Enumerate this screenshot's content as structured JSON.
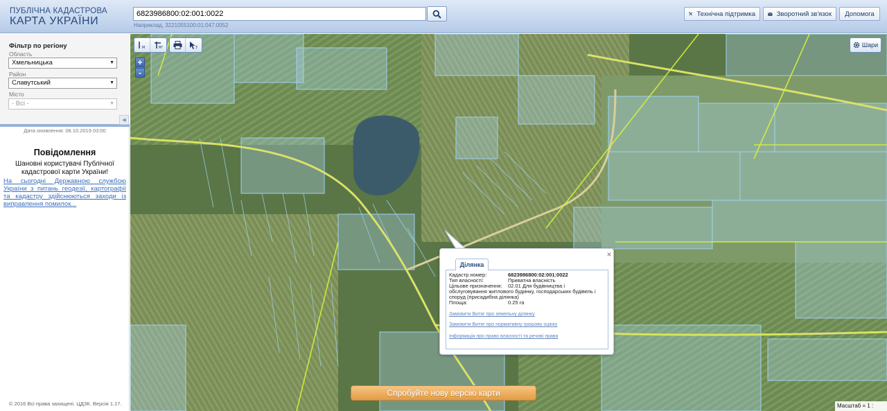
{
  "header": {
    "logo_line1": "ПУБЛІЧНА КАДАСТРОВА",
    "logo_line2": "КАРТА УКРАЇНИ",
    "search": {
      "value": "6823986800:02:001:0022",
      "hint": "Наприклад, 3221055100:01:047:0052"
    },
    "buttons": [
      {
        "label": "Технічна підтримка",
        "icon": "tools-icon"
      },
      {
        "label": "Зворотний зв'язок",
        "icon": "envelope-icon"
      },
      {
        "label": "Допомога"
      }
    ]
  },
  "sidebar": {
    "filter_title": "Фільтр по регіону",
    "region": {
      "label": "Область",
      "value": "Хмельницька"
    },
    "district": {
      "label": "Район",
      "value": "Славутський"
    },
    "city": {
      "label": "Місто",
      "value": "- Всі -"
    },
    "update_date": "Дата оновлення: 08.10.2019 03:00",
    "news": {
      "title": "Повідомлення",
      "body": "Шановні користувачі Публічної кадастрової карти України!",
      "link": "На сьогодні Державною службою України з питань геодезії, картографії та кадастру здійснюються заходи із виправлення помилок..."
    },
    "footer": "© 2016 Всі права захищені. ЦДЗК. Версія 1.17."
  },
  "map": {
    "layers_label": "Шари",
    "zoom_in": "+",
    "zoom_out": "-",
    "new_version_label": "Спробуйте нову версію карти",
    "scale": "Масштаб = 1 : 8531",
    "toolbar_icons": [
      "measure-distance-icon",
      "measure-area-icon",
      "print-icon",
      "identify-icon"
    ]
  },
  "popup": {
    "tab": "Ділянка",
    "close": "×",
    "fields": [
      {
        "label": "Кадастр.номер:",
        "value": "6823986800:02:001:0022"
      },
      {
        "label": "Тип власності:",
        "value": "Приватна власність"
      },
      {
        "label": "Цільове призначення:",
        "value": "02.01 Для будівництва і обслуговування житлового будинку, господарських будівель і споруд (присадибна ділянка)"
      },
      {
        "label": "Площа:",
        "value": "0.25 га"
      }
    ],
    "links": [
      "Замовити Витяг про земельну ділянку",
      "Замовити Витяг про нормативну грошову оцінку",
      "Інформація про право власності та речові права"
    ]
  }
}
